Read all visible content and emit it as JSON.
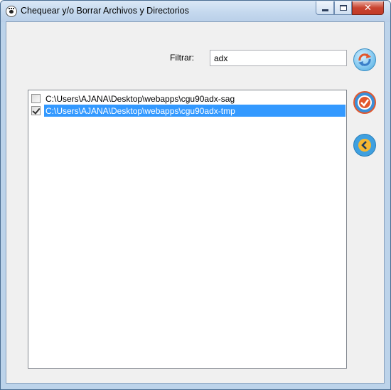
{
  "window": {
    "title": "Chequear y/o Borrar Archivos y Directorios",
    "close_glyph": "✕"
  },
  "filter": {
    "label": "Filtrar:",
    "value": "adx"
  },
  "list": {
    "items": [
      {
        "text": "C:\\Users\\AJANA\\Desktop\\webapps\\cgu90adx-sag",
        "checked": false,
        "selected": false
      },
      {
        "text": "C:\\Users\\AJANA\\Desktop\\webapps\\cgu90adx-tmp",
        "checked": true,
        "selected": true
      }
    ]
  },
  "buttons": {
    "refresh": {
      "icon": "refresh-icon"
    },
    "check": {
      "icon": "check-circle-icon"
    },
    "back": {
      "icon": "back-arrow-icon"
    }
  },
  "colors": {
    "selection": "#3399ff",
    "accent_orange": "#e2572d",
    "accent_blue": "#3a8fd8"
  }
}
